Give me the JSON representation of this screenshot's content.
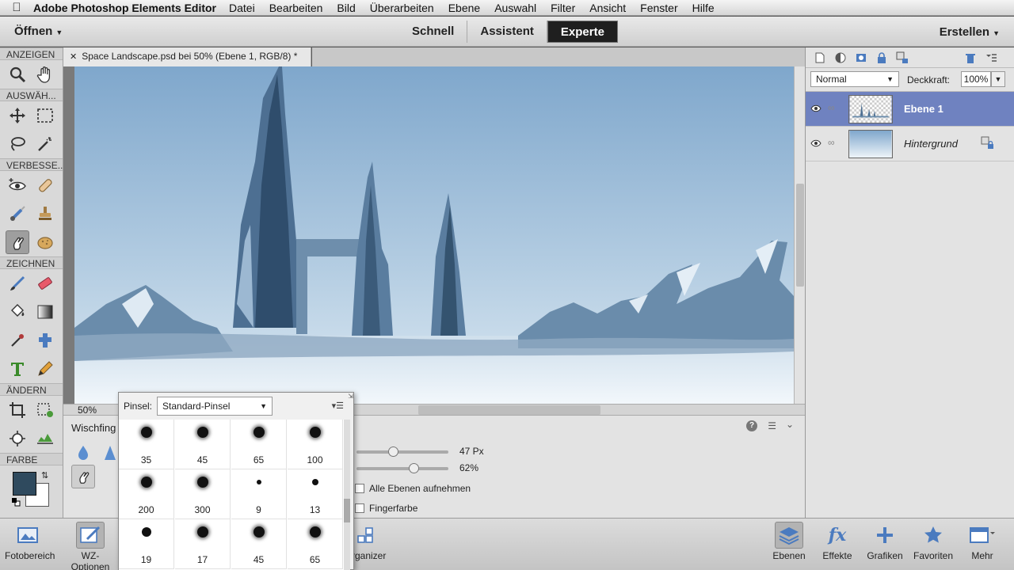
{
  "menubar": {
    "app_name": "Adobe Photoshop Elements Editor",
    "items": [
      "Datei",
      "Bearbeiten",
      "Bild",
      "Überarbeiten",
      "Ebene",
      "Auswahl",
      "Filter",
      "Ansicht",
      "Fenster",
      "Hilfe"
    ]
  },
  "modebar": {
    "open_label": "Öffnen",
    "modes": [
      "Schnell",
      "Assistent",
      "Experte"
    ],
    "active_mode": "Experte",
    "create_label": "Erstellen"
  },
  "toolbox": {
    "sections": {
      "view": "ANZEIGEN",
      "select": "AUSWÄH...",
      "enhance": "VERBESSE...",
      "draw": "ZEICHNEN",
      "modify": "ÄNDERN",
      "color": "FARBE"
    },
    "foreground_color": "#2f4a5e",
    "background_color": "#ffffff"
  },
  "document": {
    "tab_title": "Space Landscape.psd bei 50% (Ebene 1, RGB/8) *",
    "zoom": "50%"
  },
  "options": {
    "tool_name": "Wischfing",
    "size_value": "47 Px",
    "size_fraction": 0.4,
    "strength_value": "62%",
    "strength_fraction": 0.62,
    "sample_all_layers": "Alle Ebenen aufnehmen",
    "finger_paint": "Fingerfarbe"
  },
  "brush_picker": {
    "label": "Pinsel:",
    "selected": "Standard-Pinsel",
    "brushes": [
      {
        "size": "35",
        "soft": true
      },
      {
        "size": "45",
        "soft": true
      },
      {
        "size": "65",
        "soft": true
      },
      {
        "size": "100",
        "soft": true
      },
      {
        "size": "200",
        "soft": true
      },
      {
        "size": "300",
        "soft": true
      },
      {
        "size": "9",
        "soft": false
      },
      {
        "size": "13",
        "soft": false
      },
      {
        "size": "19",
        "soft": false
      },
      {
        "size": "17",
        "soft": true
      },
      {
        "size": "45",
        "soft": true
      },
      {
        "size": "65",
        "soft": true
      }
    ]
  },
  "layers": {
    "blend_mode": "Normal",
    "opacity_label": "Deckkraft:",
    "opacity_value": "100%",
    "items": [
      {
        "name": "Ebene 1",
        "active": true
      },
      {
        "name": "Hintergrund",
        "active": false
      }
    ],
    "accent": "#6f82c0"
  },
  "bottombar": {
    "left": [
      {
        "label": "Fotobereich"
      },
      {
        "label": "WZ-Optionen"
      }
    ],
    "organizer": "Organizer",
    "right": [
      {
        "label": "Ebenen"
      },
      {
        "label": "Effekte"
      },
      {
        "label": "Grafiken"
      },
      {
        "label": "Favoriten"
      },
      {
        "label": "Mehr"
      }
    ]
  }
}
